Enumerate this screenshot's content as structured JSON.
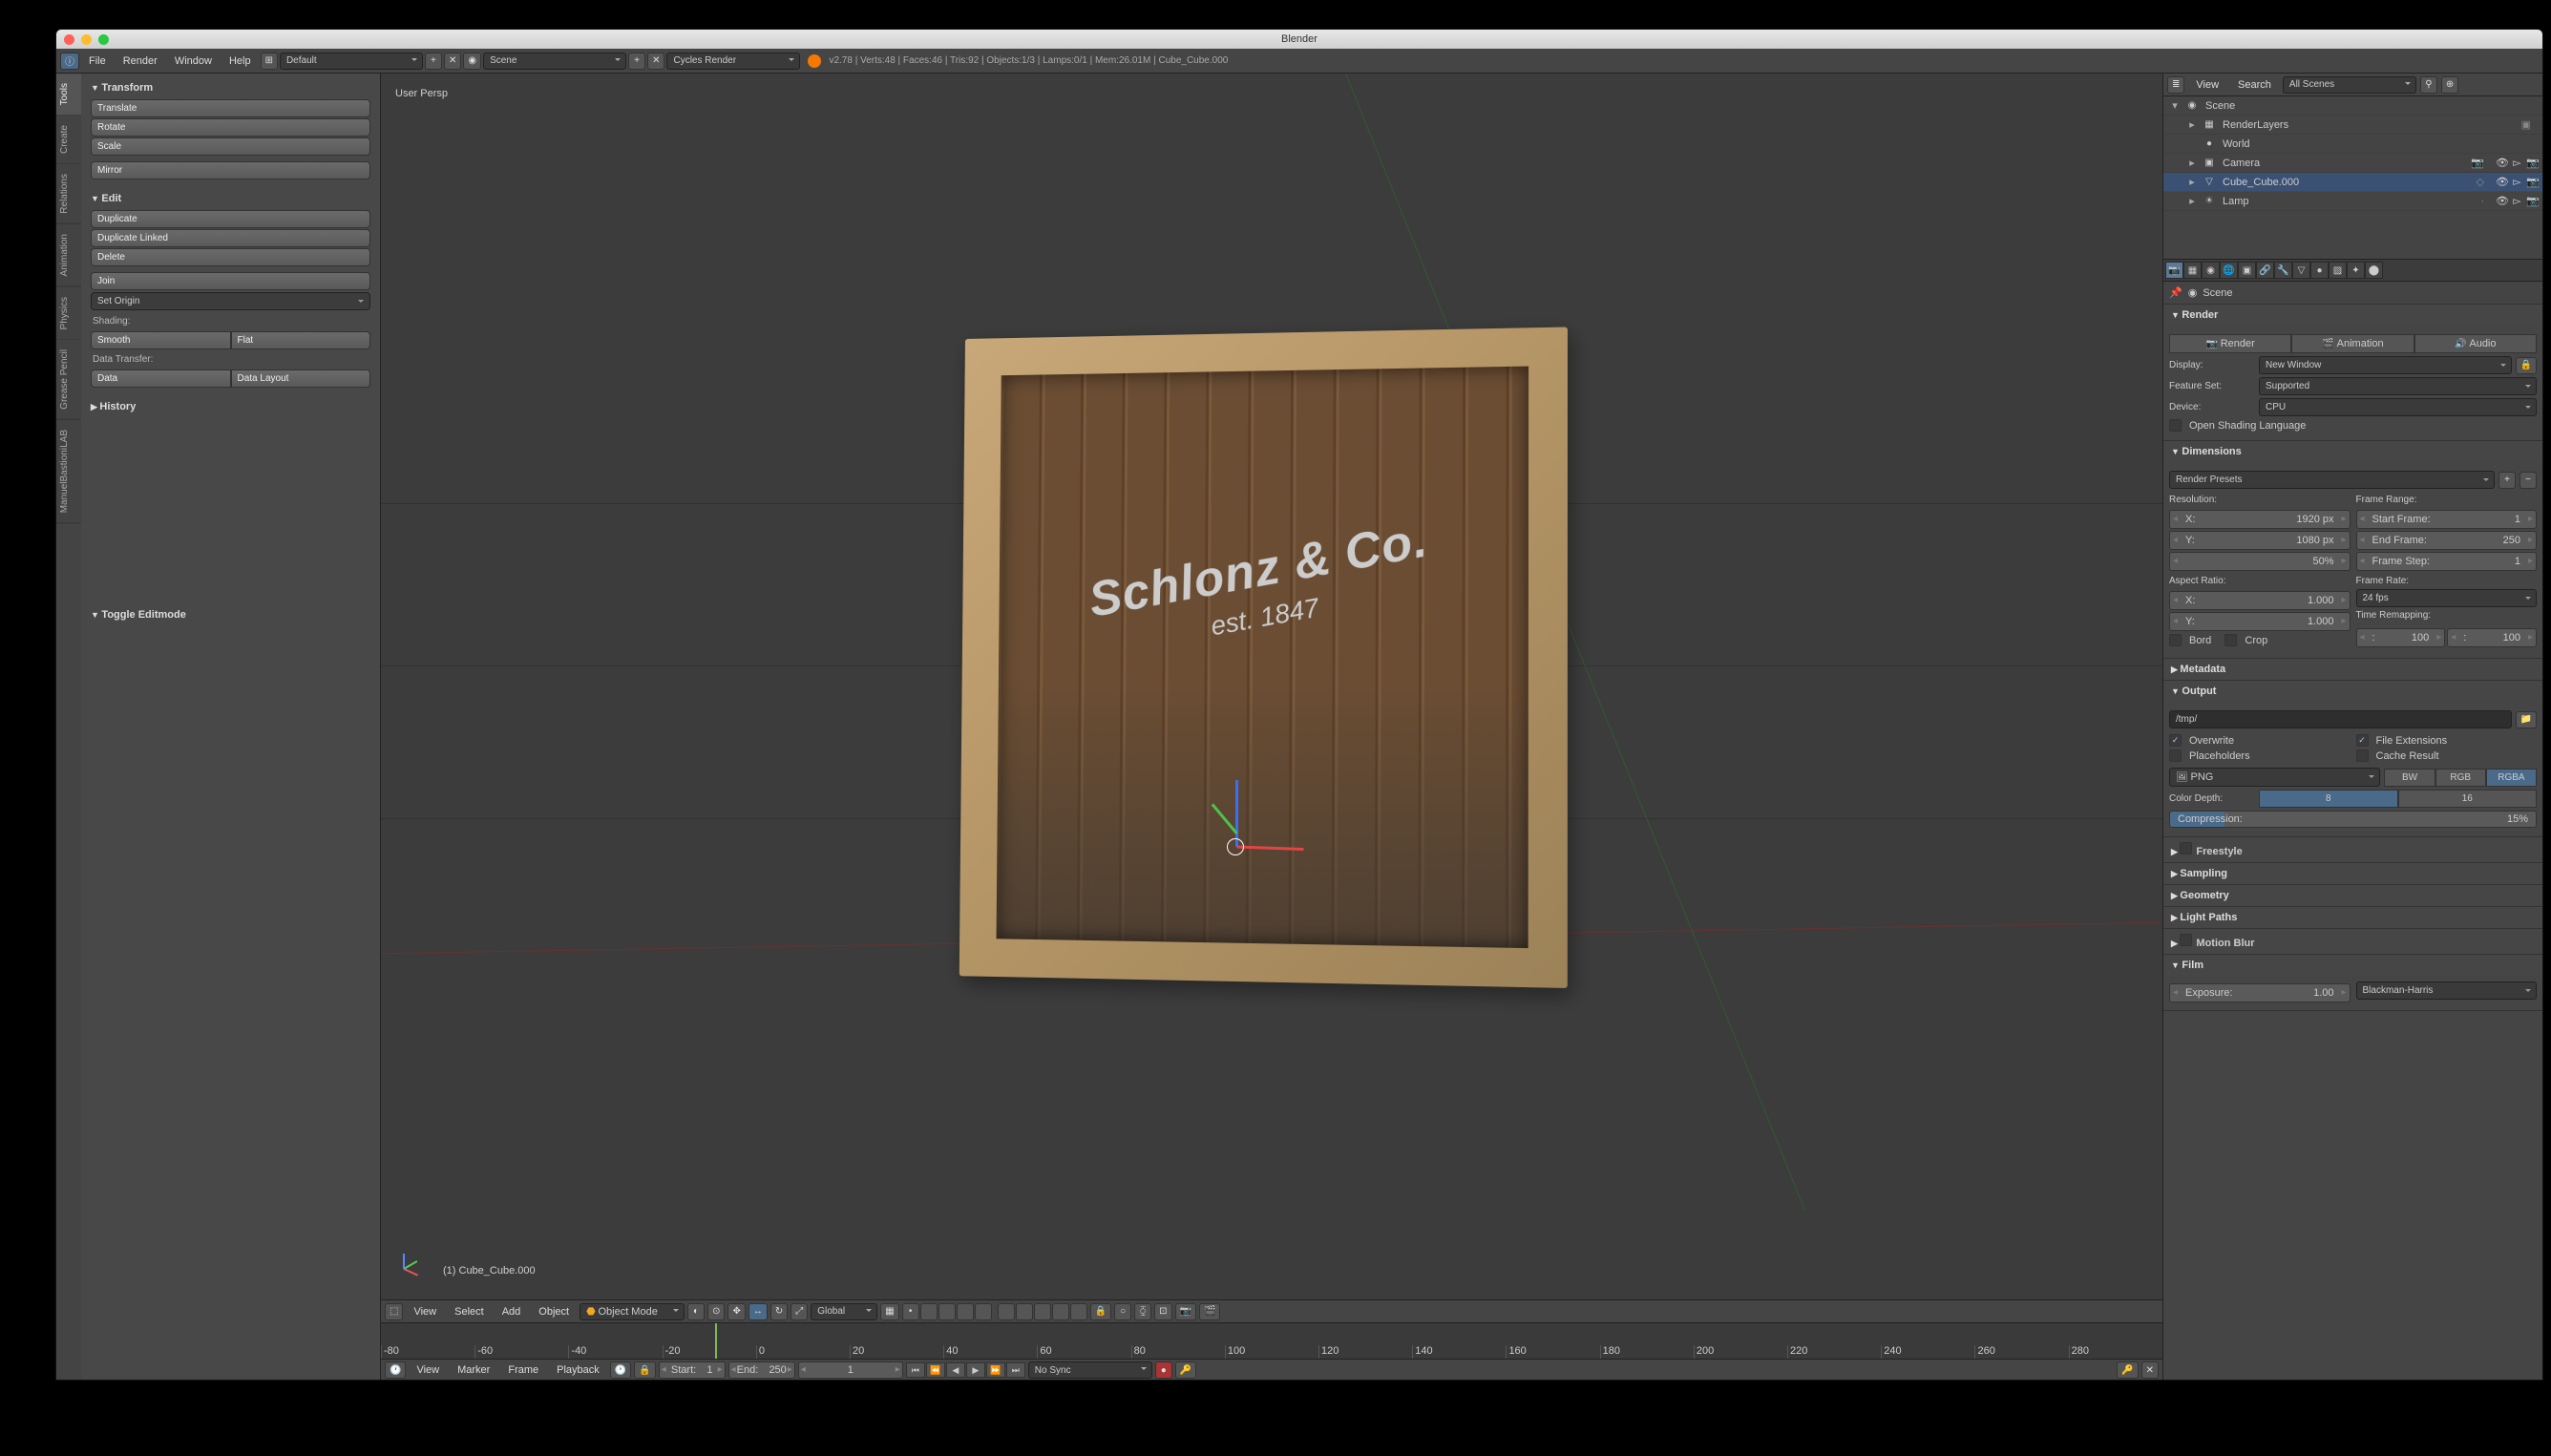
{
  "app": {
    "title": "Blender"
  },
  "topbar": {
    "menus": {
      "file": "File",
      "render": "Render",
      "window": "Window",
      "help": "Help"
    },
    "layout": "Default",
    "scene": "Scene",
    "engine": "Cycles Render",
    "version_stats": "v2.78 | Verts:48 | Faces:46 | Tris:92 | Objects:1/3 | Lamps:0/1 | Mem:26.01M | Cube_Cube.000"
  },
  "toolshelf": {
    "tabs": [
      "Tools",
      "Create",
      "Relations",
      "Animation",
      "Physics",
      "Grease Pencil",
      "ManuelBastioniLAB"
    ],
    "transform": {
      "title": "Transform",
      "translate": "Translate",
      "rotate": "Rotate",
      "scale": "Scale",
      "mirror": "Mirror"
    },
    "edit": {
      "title": "Edit",
      "duplicate": "Duplicate",
      "duplicate_linked": "Duplicate Linked",
      "delete": "Delete",
      "join": "Join",
      "set_origin": "Set Origin"
    },
    "shading": {
      "label": "Shading:",
      "smooth": "Smooth",
      "flat": "Flat"
    },
    "data_transfer": {
      "label": "Data Transfer:",
      "data": "Data",
      "data_layout": "Data Layout"
    },
    "history": {
      "title": "History"
    },
    "last_op": {
      "title": "Toggle Editmode"
    }
  },
  "viewport": {
    "persp": "User Persp",
    "selected_label": "(1) Cube_Cube.000",
    "brand_line1": "Schlonz & Co.",
    "brand_line2": "est. 1847",
    "header": {
      "view": "View",
      "select": "Select",
      "add": "Add",
      "object": "Object",
      "mode": "Object Mode",
      "orientation": "Global"
    }
  },
  "timeline": {
    "ticks": [
      "-80",
      "-60",
      "-40",
      "-20",
      "0",
      "20",
      "40",
      "60",
      "80",
      "100",
      "120",
      "140",
      "160",
      "180",
      "200",
      "220",
      "240",
      "260",
      "280"
    ],
    "header": {
      "view": "View",
      "marker": "Marker",
      "frame": "Frame",
      "playback": "Playback",
      "start_label": "Start:",
      "start": "1",
      "end_label": "End:",
      "end": "250",
      "current": "1",
      "sync": "No Sync"
    }
  },
  "outliner": {
    "view": "View",
    "search": "Search",
    "filter": "All Scenes",
    "items": [
      {
        "name": "Scene",
        "depth": 0,
        "expand": "▾",
        "icon": "◉",
        "sel": false
      },
      {
        "name": "RenderLayers",
        "depth": 1,
        "expand": "▸",
        "icon": "▦",
        "sel": false,
        "extra": "▣"
      },
      {
        "name": "World",
        "depth": 1,
        "expand": "",
        "icon": "●",
        "sel": false
      },
      {
        "name": "Camera",
        "depth": 1,
        "expand": "▸",
        "icon": "▣",
        "sel": false,
        "show": true,
        "extra": "📷"
      },
      {
        "name": "Cube_Cube.000",
        "depth": 1,
        "expand": "▸",
        "icon": "▽",
        "sel": true,
        "show": true,
        "extra": "◇"
      },
      {
        "name": "Lamp",
        "depth": 1,
        "expand": "▸",
        "icon": "☀",
        "sel": false,
        "show": true,
        "extra": "·"
      }
    ]
  },
  "properties": {
    "breadcrumb": "Scene",
    "render": {
      "title": "Render",
      "render_btn": "Render",
      "animation_btn": "Animation",
      "audio_btn": "Audio",
      "display_label": "Display:",
      "display": "New Window",
      "featureset_label": "Feature Set:",
      "featureset": "Supported",
      "device_label": "Device:",
      "device": "CPU",
      "osl": "Open Shading Language"
    },
    "dimensions": {
      "title": "Dimensions",
      "presets": "Render Presets",
      "resolution_label": "Resolution:",
      "res_x_label": "X:",
      "res_x": "1920 px",
      "res_y_label": "Y:",
      "res_y": "1080 px",
      "res_pct": "50%",
      "framerange_label": "Frame Range:",
      "start_label": "Start Frame:",
      "start": "1",
      "end_label": "End Frame:",
      "end": "250",
      "step_label": "Frame Step:",
      "step": "1",
      "aspect_label": "Aspect Ratio:",
      "ax_label": "X:",
      "ax": "1.000",
      "ay_label": "Y:",
      "ay": "1.000",
      "framerate_label": "Frame Rate:",
      "framerate": "24 fps",
      "remapping_label": "Time Remapping:",
      "remap_old": "100",
      "remap_new": "100",
      "border": "Bord",
      "crop": "Crop"
    },
    "metadata": {
      "title": "Metadata"
    },
    "output": {
      "title": "Output",
      "path": "/tmp/",
      "overwrite": "Overwrite",
      "file_ext": "File Extensions",
      "placeholders": "Placeholders",
      "cache": "Cache Result",
      "format": "PNG",
      "bw": "BW",
      "rgb": "RGB",
      "rgba": "RGBA",
      "colordepth_label": "Color Depth:",
      "cd8": "8",
      "cd16": "16",
      "compression_label": "Compression:",
      "compression": "15%"
    },
    "collapsed": {
      "freestyle": "Freestyle",
      "sampling": "Sampling",
      "geometry": "Geometry",
      "lightpaths": "Light Paths",
      "motionblur": "Motion Blur",
      "film": "Film"
    },
    "film": {
      "exposure_label": "Exposure:",
      "exposure": "1.00",
      "filter": "Blackman-Harris"
    }
  }
}
